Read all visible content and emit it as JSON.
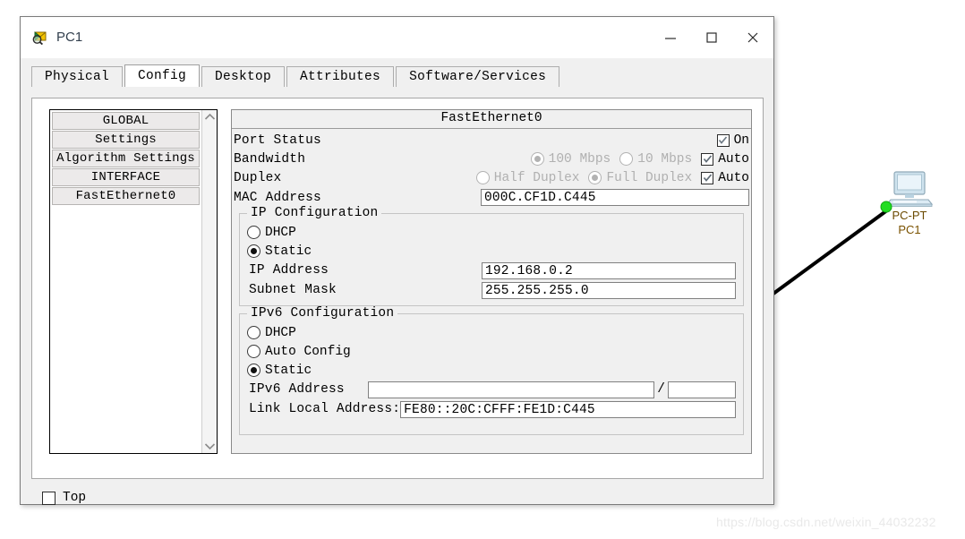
{
  "window": {
    "title": "PC1",
    "app_icon": "packet-tracer-icon",
    "controls": {
      "minimize": "minimize-icon",
      "maximize": "maximize-icon",
      "close": "close-icon"
    }
  },
  "tabs": [
    {
      "label": "Physical",
      "active": false
    },
    {
      "label": "Config",
      "active": true
    },
    {
      "label": "Desktop",
      "active": false
    },
    {
      "label": "Attributes",
      "active": false
    },
    {
      "label": "Software/Services",
      "active": false
    }
  ],
  "sidebar": {
    "items": [
      {
        "label": "GLOBAL",
        "kind": "category"
      },
      {
        "label": "Settings",
        "kind": "item"
      },
      {
        "label": "Algorithm Settings",
        "kind": "item"
      },
      {
        "label": "INTERFACE",
        "kind": "category"
      },
      {
        "label": "FastEthernet0",
        "kind": "item"
      }
    ],
    "scroll_up": "chevron-up-icon",
    "scroll_down": "chevron-down-icon"
  },
  "interface_panel": {
    "header": "FastEthernet0",
    "port_status": {
      "label": "Port Status",
      "checkbox_label": "On",
      "checked": true
    },
    "bandwidth": {
      "label": "Bandwidth",
      "option_100": "100 Mbps",
      "option_10": "10 Mbps",
      "selected": "100 Mbps",
      "auto_label": "Auto",
      "auto_checked": true,
      "disabled": true
    },
    "duplex": {
      "label": "Duplex",
      "option_half": "Half Duplex",
      "option_full": "Full Duplex",
      "selected": "Full Duplex",
      "auto_label": "Auto",
      "auto_checked": true,
      "disabled": true
    },
    "mac": {
      "label": "MAC Address",
      "value": "000C.CF1D.C445"
    },
    "ip_config": {
      "title": "IP Configuration",
      "dhcp_label": "DHCP",
      "static_label": "Static",
      "selected": "Static",
      "ip_address_label": "IP Address",
      "ip_address_value": "192.168.0.2",
      "subnet_label": "Subnet Mask",
      "subnet_value": "255.255.255.0"
    },
    "ipv6_config": {
      "title": "IPv6 Configuration",
      "dhcp_label": "DHCP",
      "auto_config_label": "Auto Config",
      "static_label": "Static",
      "selected": "Static",
      "ipv6_address_label": "IPv6 Address",
      "ipv6_address_value": "",
      "ipv6_prefix_separator": "/",
      "ipv6_prefix_value": "",
      "link_local_label": "Link Local Address:",
      "link_local_value": "FE80::20C:CFFF:FE1D:C445"
    }
  },
  "bottom": {
    "top_checkbox_label": "Top",
    "top_checked": false
  },
  "workspace": {
    "node": {
      "type_label": "PC-PT",
      "name_label": "PC1",
      "icon": "pc-desktop-icon",
      "link_status": "up"
    },
    "watermark": "https://blog.csdn.net/weixin_44032232"
  },
  "colors": {
    "window_bg": "#f0f0f0",
    "panel_bg": "#ffffff",
    "border": "#8a8a8a",
    "title_text": "#33404e",
    "node_label": "#6b4a00",
    "link_up": "#22dd22",
    "watermark": "#e9e9e9"
  }
}
